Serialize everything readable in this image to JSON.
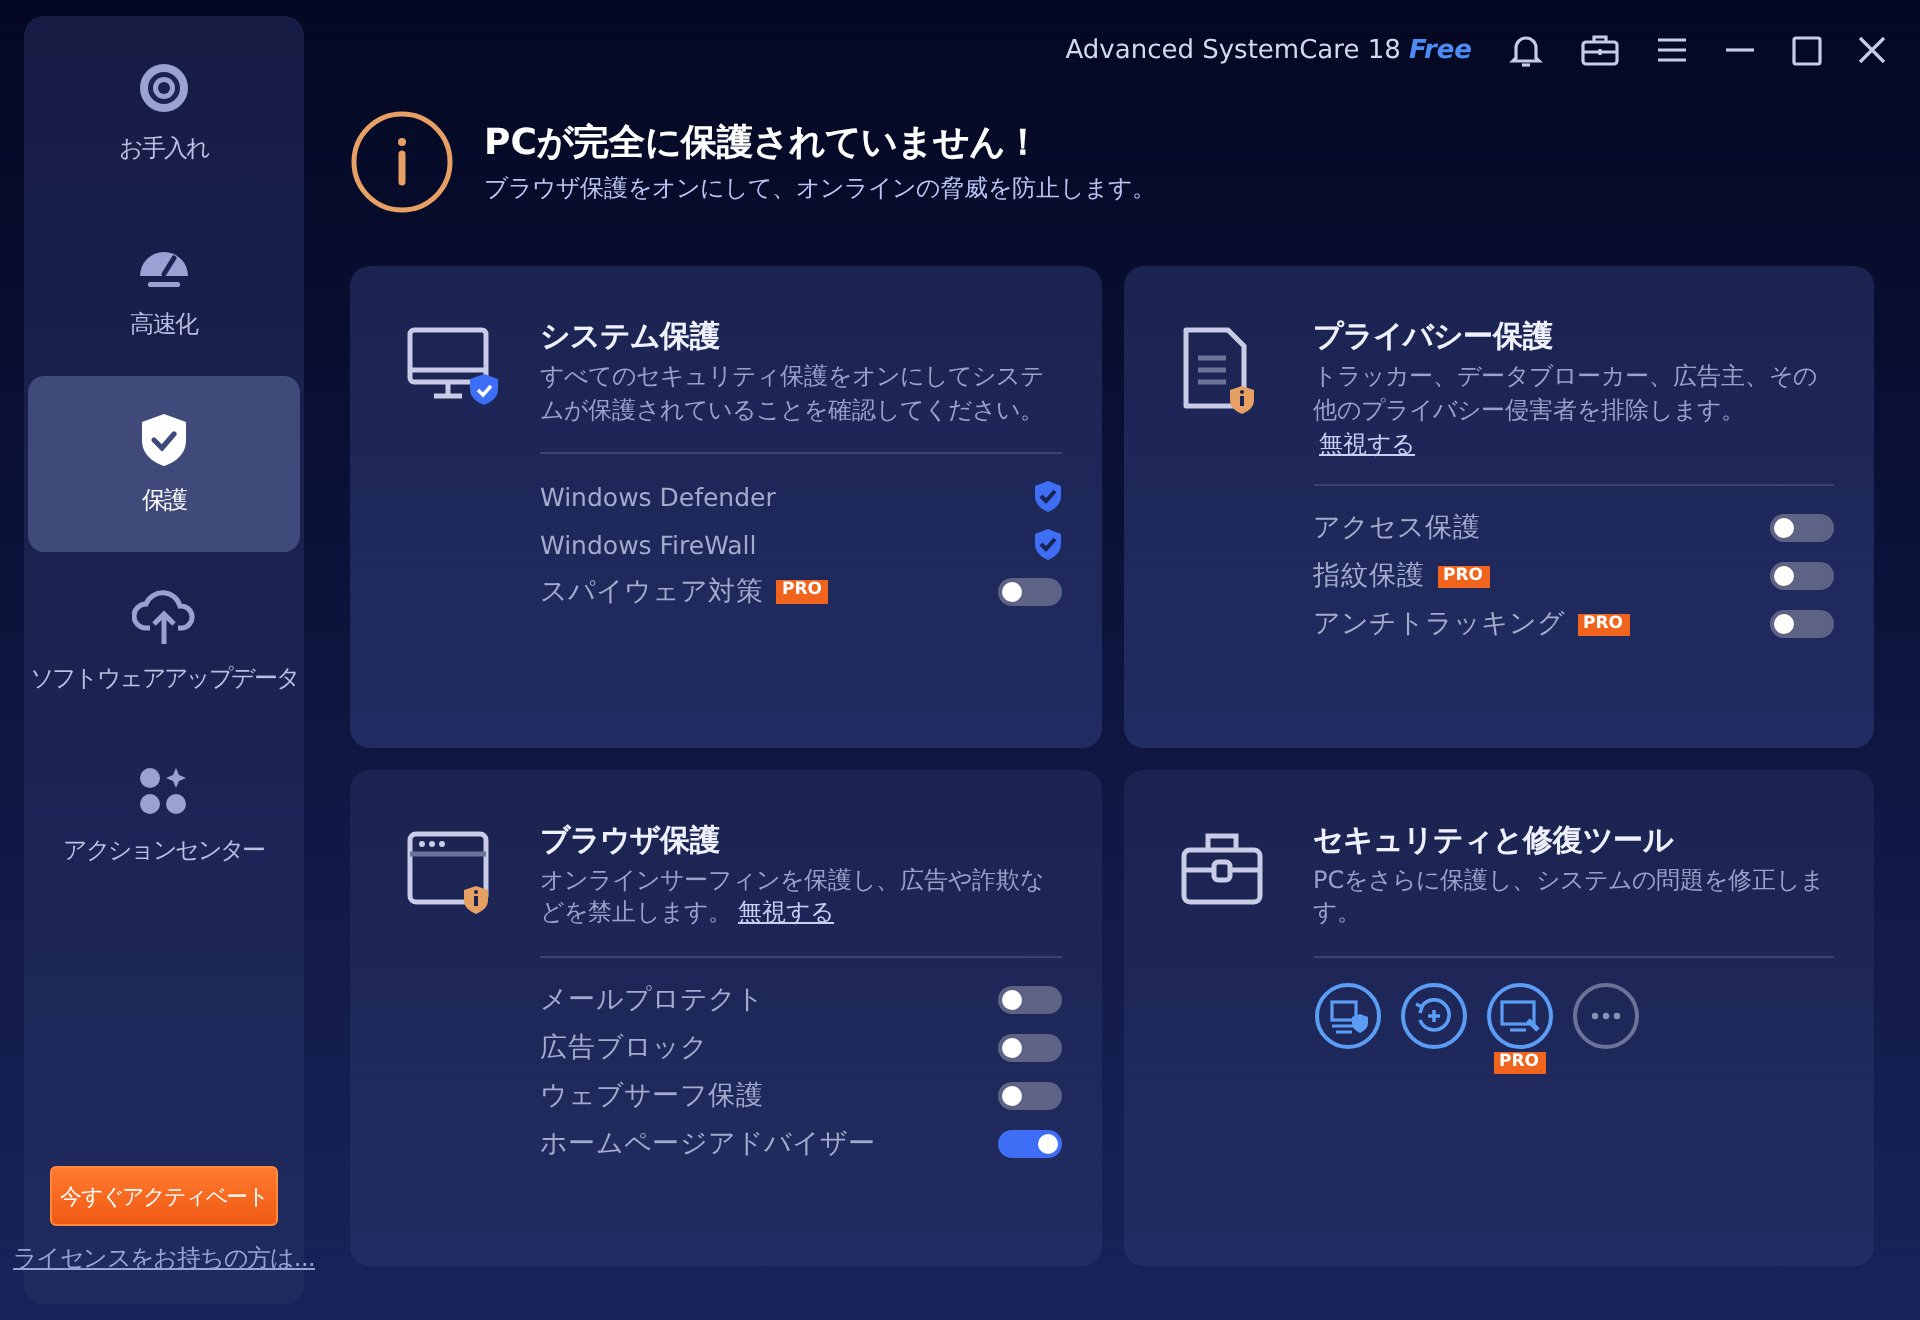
{
  "window": {
    "title": "Advanced SystemCare 18",
    "edition": "Free"
  },
  "nav": [
    {
      "kind": "clean",
      "label": "お手入れ",
      "selected": false
    },
    {
      "kind": "speed",
      "label": "高速化",
      "selected": false
    },
    {
      "kind": "protect",
      "label": "保護",
      "selected": true
    },
    {
      "kind": "update",
      "label": "ソフトウェアアップデータ",
      "selected": false
    },
    {
      "kind": "action",
      "label": "アクションセンター",
      "selected": false
    }
  ],
  "activate_button": "今すぐアクティベート",
  "license_link": "ライセンスをお持ちの方は...",
  "alert": {
    "title": "PCが完全に保護されていません！",
    "subtitle": "ブラウザ保護をオンにして、オンラインの脅威を防止します。"
  },
  "cards": [
    {
      "kind": "system",
      "title": "システム保護",
      "description": "すべてのセキュリティ保護をオンにしてシステムが保護されていることを確認してください。",
      "items": [
        {
          "kind": "status",
          "label": "Windows Defender"
        },
        {
          "kind": "status",
          "label": "Windows FireWall"
        },
        {
          "kind": "toggle",
          "label": "スパイウェア対策",
          "badge": "PRO",
          "on": false
        }
      ]
    },
    {
      "kind": "privacy",
      "title": "プライバシー保護",
      "description": "トラッカー、データブローカー、広告主、その他のプライバシー侵害者を排除します。",
      "link": "無視する",
      "items": [
        {
          "kind": "toggle",
          "label": "アクセス保護",
          "on": false
        },
        {
          "kind": "toggle",
          "label": "指紋保護",
          "badge": "PRO",
          "on": false
        },
        {
          "kind": "toggle",
          "label": "アンチトラッキング",
          "badge": "PRO",
          "on": false
        }
      ]
    },
    {
      "kind": "browser",
      "title": "ブラウザ保護",
      "description": "オンラインサーフィンを保護し、広告や詐欺などを禁止します。",
      "link": "無視する",
      "items": [
        {
          "kind": "toggle",
          "label": "メールプロテクト",
          "on": false
        },
        {
          "kind": "toggle",
          "label": "広告ブロック",
          "on": false
        },
        {
          "kind": "toggle",
          "label": "ウェブサーフ保護",
          "on": false
        },
        {
          "kind": "toggle",
          "label": "ホームページアドバイザー",
          "on": true
        }
      ]
    },
    {
      "kind": "tools",
      "title": "セキュリティと修復ツール",
      "description": "PCをさらに保護し、システムの問題を修正します。",
      "tools": [
        {
          "kind": "pcshield"
        },
        {
          "kind": "restore"
        },
        {
          "kind": "repair",
          "badge": "PRO"
        },
        {
          "kind": "more"
        }
      ]
    }
  ]
}
